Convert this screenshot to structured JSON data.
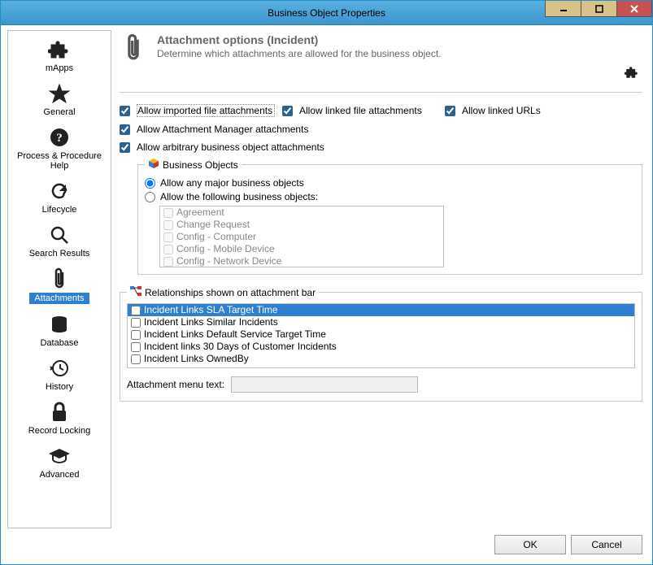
{
  "window_title": "Business Object Properties",
  "sidebar": {
    "items": [
      {
        "label": "mApps"
      },
      {
        "label": "General"
      },
      {
        "label": "Process & Procedure\nHelp"
      },
      {
        "label": "Lifecycle"
      },
      {
        "label": "Search Results"
      },
      {
        "label": "Attachments",
        "selected": true
      },
      {
        "label": "Database"
      },
      {
        "label": "History"
      },
      {
        "label": "Record Locking"
      },
      {
        "label": "Advanced"
      }
    ]
  },
  "header": {
    "title": "Attachment options  (Incident)",
    "description": "Determine which attachments are allowed for the business object."
  },
  "checks": {
    "imported": "Allow imported file attachments",
    "linked_file": "Allow linked file attachments",
    "linked_urls": "Allow linked URLs",
    "manager": "Allow Attachment Manager attachments",
    "arbitrary": "Allow arbitrary business object attachments"
  },
  "bo": {
    "legend": "Business Objects",
    "radio_any": "Allow any major business objects",
    "radio_following": "Allow the following business objects:",
    "items": [
      "Agreement",
      "Change Request",
      "Config - Computer",
      "Config - Mobile Device",
      "Config - Network Device"
    ]
  },
  "rel": {
    "legend": "Relationships shown on attachment bar",
    "items": [
      "Incident Links SLA Target Time",
      "Incident Links Similar Incidents",
      "Incident Links Default Service Target Time",
      "Incident links 30 Days of Customer Incidents",
      "Incident Links OwnedBy"
    ],
    "menu_text_label": "Attachment menu text:",
    "menu_text_value": ""
  },
  "buttons": {
    "ok": "OK",
    "cancel": "Cancel"
  }
}
